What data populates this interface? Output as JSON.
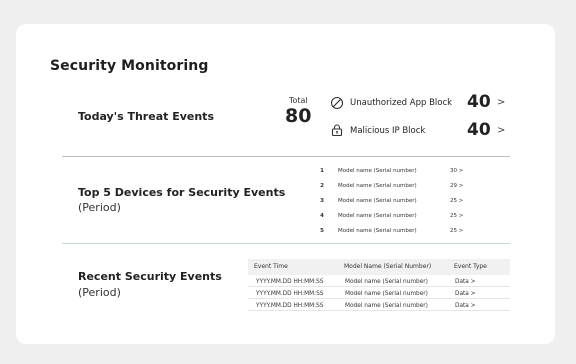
{
  "title": "Security Monitoring",
  "threats": {
    "heading": "Today's Threat Events",
    "total_label": "Total",
    "total_value": "80",
    "items": [
      {
        "label": "Unauthorized App Block",
        "value": "40",
        "chevron": ">",
        "icon": "block-icon"
      },
      {
        "label": "Malicious IP Block",
        "value": "40",
        "chevron": ">",
        "icon": "lock-icon"
      }
    ]
  },
  "top5": {
    "heading": "Top 5 Devices for Security Events",
    "period": "(Period)",
    "rows": [
      {
        "rank": "1",
        "model": "Model name (Serial number)",
        "value": "30 >"
      },
      {
        "rank": "2",
        "model": "Model name (Serial number)",
        "value": "29 >"
      },
      {
        "rank": "3",
        "model": "Model name (Serial number)",
        "value": "25 >"
      },
      {
        "rank": "4",
        "model": "Model name (Serial number)",
        "value": "25 >"
      },
      {
        "rank": "5",
        "model": "Model name (Serial number)",
        "value": "25 >"
      }
    ]
  },
  "recent": {
    "heading": "Recent Security Events",
    "period": "(Period)",
    "columns": [
      "Event Time",
      "Model Name (Serial Number)",
      "Event Type"
    ],
    "rows": [
      {
        "time": "YYYY.MM.DD HH:MM:SS",
        "model": "Model name (Serial number)",
        "type": "Data >"
      },
      {
        "time": "YYYY.MM.DD HH:MM:SS",
        "model": "Model name (Serial number)",
        "type": "Data >"
      },
      {
        "time": "YYYY.MM.DD HH:MM:SS",
        "model": "Model name (Serial number)",
        "type": "Data >"
      }
    ]
  },
  "colors": {
    "divider_top": "#bdbdbd",
    "divider_bottom": "#bcd9d6",
    "card": "#ffffff",
    "background": "#efefef"
  }
}
